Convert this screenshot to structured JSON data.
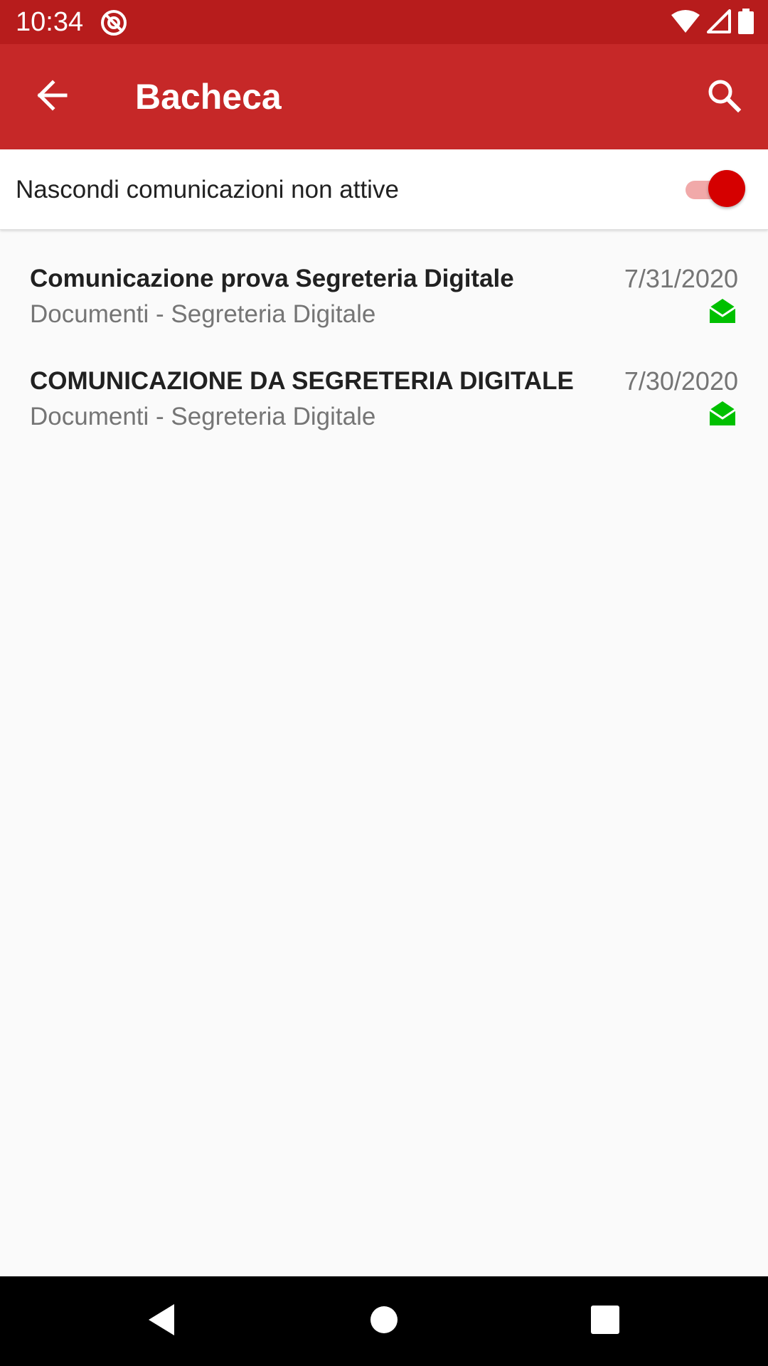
{
  "status_bar": {
    "time": "10:34",
    "app_icon": "at-sign-icon",
    "icons": [
      "wifi-icon",
      "signal-icon",
      "battery-icon"
    ]
  },
  "app_bar": {
    "title": "Bacheca",
    "back_icon": "arrow-back-icon",
    "search_icon": "search-icon",
    "color": "#c62828",
    "status_color": "#b71c1c"
  },
  "filter": {
    "label": "Nascondi comunicazioni non attive",
    "enabled": true,
    "accent": "#d50000"
  },
  "communications": [
    {
      "title": "Comunicazione prova Segreteria Digitale",
      "subtitle": "Documenti - Segreteria Digitale",
      "date": "7/31/2020",
      "icon": "envelope-open-icon",
      "icon_color": "#00c000"
    },
    {
      "title": "COMUNICAZIONE DA SEGRETERIA DIGITALE",
      "subtitle": "Documenti - Segreteria Digitale",
      "date": "7/30/2020",
      "icon": "envelope-open-icon",
      "icon_color": "#00c000"
    }
  ],
  "nav_bar": {
    "buttons": [
      "nav-back-icon",
      "nav-home-icon",
      "nav-recents-icon"
    ]
  }
}
